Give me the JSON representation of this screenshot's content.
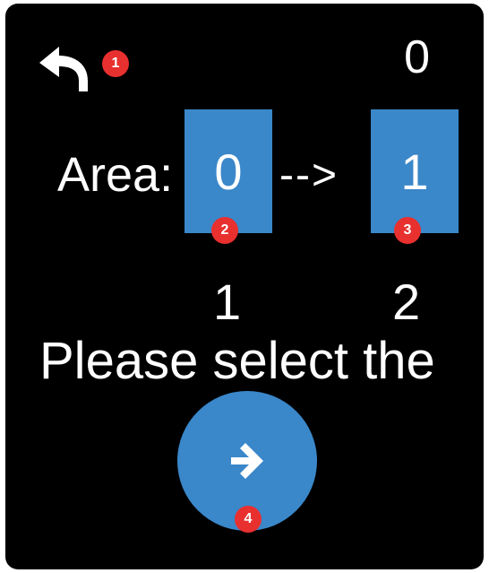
{
  "header": {
    "back_icon": "undo-arrow-icon",
    "counter": "0"
  },
  "area": {
    "label": "Area:",
    "from_value": "0",
    "arrow": "-->",
    "to_value": "1"
  },
  "below_numbers": [
    "1",
    "2"
  ],
  "prompt": "Please select the",
  "next_button_icon": "arrow-right-icon",
  "annotations": [
    "1",
    "2",
    "3",
    "4"
  ],
  "colors": {
    "background": "#000000",
    "accent": "#3a87c9",
    "badge": "#e8302f"
  }
}
